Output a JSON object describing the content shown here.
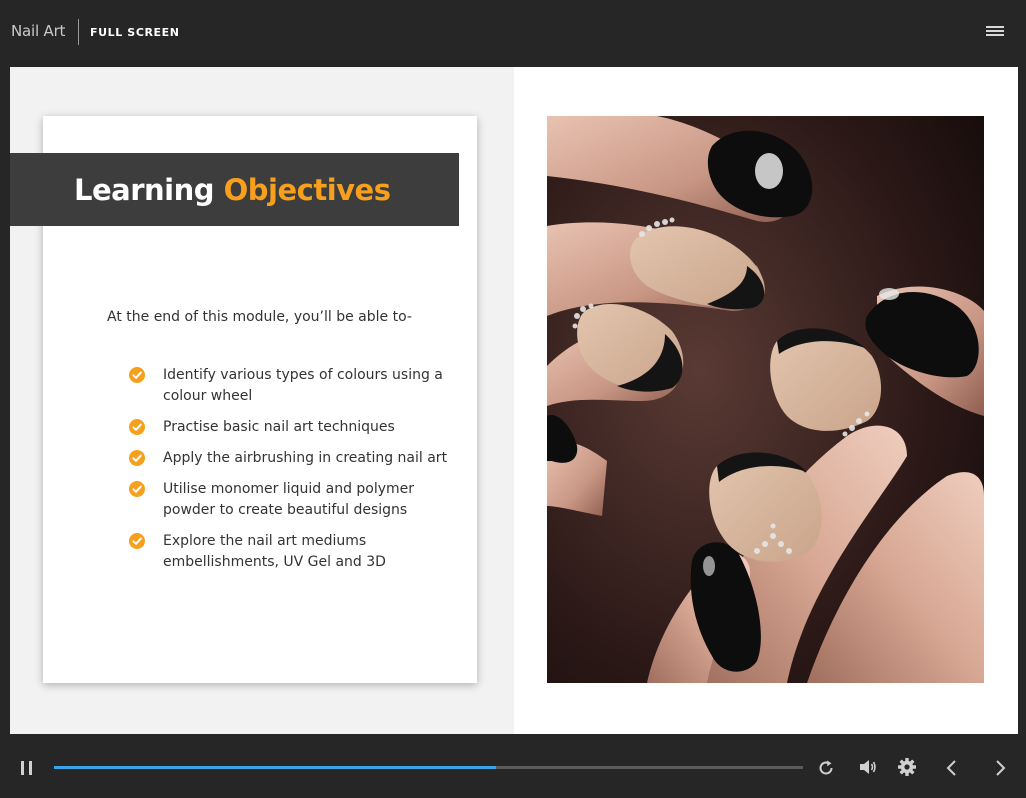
{
  "header": {
    "app_title": "Nail Art",
    "fullscreen_label": "FULL SCREEN"
  },
  "slide": {
    "heading_primary": "Learning",
    "heading_accent": "Objectives",
    "intro": "At the end of this module, you’ll be able to-",
    "objectives": [
      "Identify various types of colours using a colour wheel",
      "Practise basic nail art techniques",
      "Apply the airbrushing in creating nail art",
      "Utilise monomer liquid and polymer powder to create beautiful designs",
      "Explore the nail art mediums embellishments, UV Gel and 3D"
    ]
  },
  "player": {
    "progress_fraction": 0.59
  },
  "colors": {
    "accent": "#f7a01d",
    "progress": "#3ba4e6",
    "chrome": "#262626",
    "header_band": "#3d3d3d"
  },
  "icons": [
    "menu-icon",
    "check-icon",
    "pause-icon",
    "replay-icon",
    "volume-icon",
    "gear-icon",
    "chevron-left-icon",
    "chevron-right-icon"
  ]
}
